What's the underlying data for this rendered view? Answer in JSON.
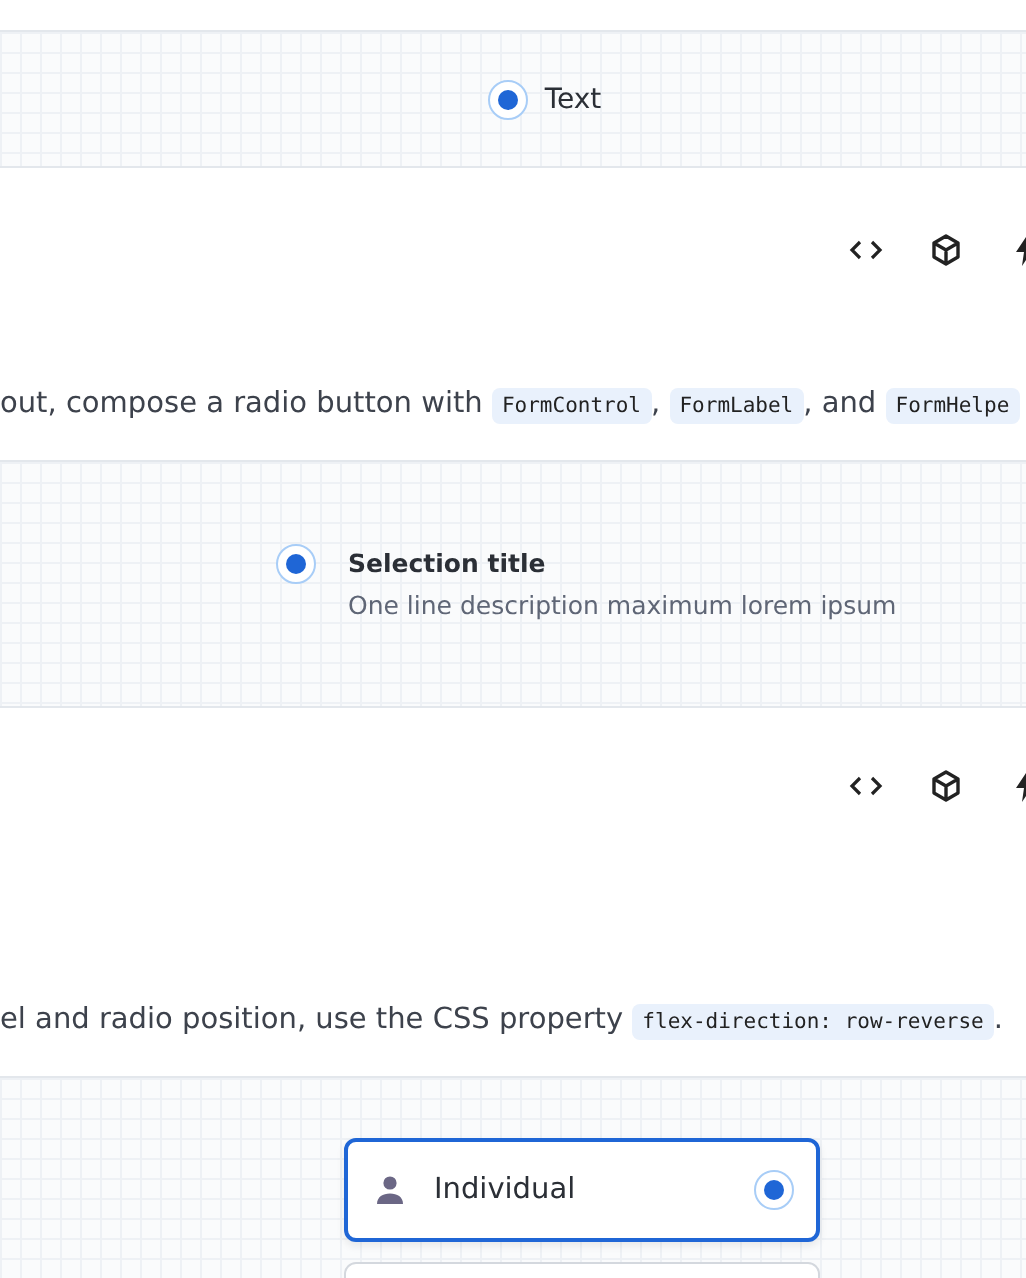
{
  "sections": [
    {
      "kind": "inline",
      "radios": [
        {
          "label": "Text",
          "selected": true
        }
      ]
    },
    {
      "kind": "toolbar"
    },
    {
      "kind": "paragraph",
      "parts": [
        {
          "kind": "text",
          "text": "out, compose a radio button with "
        },
        {
          "kind": "code",
          "text": "FormControl"
        },
        {
          "kind": "text",
          "text": ", "
        },
        {
          "kind": "code",
          "text": "FormLabel"
        },
        {
          "kind": "text",
          "text": ", and "
        },
        {
          "kind": "code",
          "text": "FormHelpe"
        }
      ]
    },
    {
      "kind": "described",
      "radios": [
        {
          "label": "Selection title",
          "description": "One line description maximum lorem ipsum",
          "selected": true
        }
      ]
    },
    {
      "kind": "toolbar"
    },
    {
      "kind": "paragraph",
      "parts": [
        {
          "kind": "text",
          "text": "el and radio position, use the CSS property "
        },
        {
          "kind": "code",
          "text": "flex-direction: row-reverse"
        },
        {
          "kind": "text",
          "text": "."
        }
      ]
    },
    {
      "kind": "cards",
      "radios": [
        {
          "label": "Individual",
          "selected": true
        },
        {
          "selected": false
        }
      ]
    }
  ]
}
